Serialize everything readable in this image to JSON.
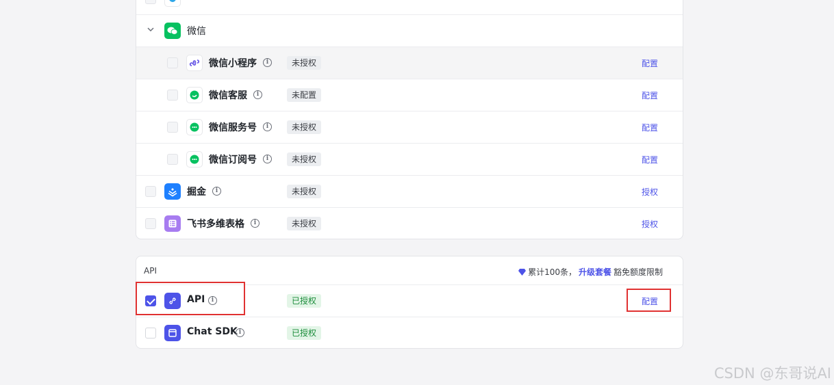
{
  "wechat_group": {
    "label": "微信",
    "icon": "wechat-icon",
    "items": [
      {
        "name": "微信小程序",
        "status": "未授权",
        "action": "配置",
        "icon": "miniprogram-icon"
      },
      {
        "name": "微信客服",
        "status": "未配置",
        "action": "配置",
        "icon": "wechat-service-icon"
      },
      {
        "name": "微信服务号",
        "status": "未授权",
        "action": "配置",
        "icon": "wechat-chat-icon"
      },
      {
        "name": "微信订阅号",
        "status": "未授权",
        "action": "配置",
        "icon": "wechat-chat-icon"
      }
    ]
  },
  "other_channels": [
    {
      "name": "掘金",
      "status": "未授权",
      "action": "授权",
      "icon": "juejin-icon"
    },
    {
      "name": "飞书多维表格",
      "status": "未授权",
      "action": "授权",
      "icon": "feishu-bitable-icon"
    }
  ],
  "api_section": {
    "title": "API",
    "quota_prefix": "累计100条，",
    "upgrade_link": "升级套餐",
    "quota_suffix": "豁免额度限制",
    "items": [
      {
        "name": "API",
        "status": "已授权",
        "action": "配置",
        "checked": true,
        "icon": "api-link-icon"
      },
      {
        "name": "Chat SDK",
        "status": "已授权",
        "action": "",
        "checked": false,
        "icon": "chat-sdk-window-icon"
      }
    ]
  },
  "watermark": "CSDN @东哥说AI",
  "colors": {
    "accent": "#4d53e8",
    "success": "#1b8c3a",
    "highlight": "#e03131",
    "wechat": "#07c160"
  }
}
